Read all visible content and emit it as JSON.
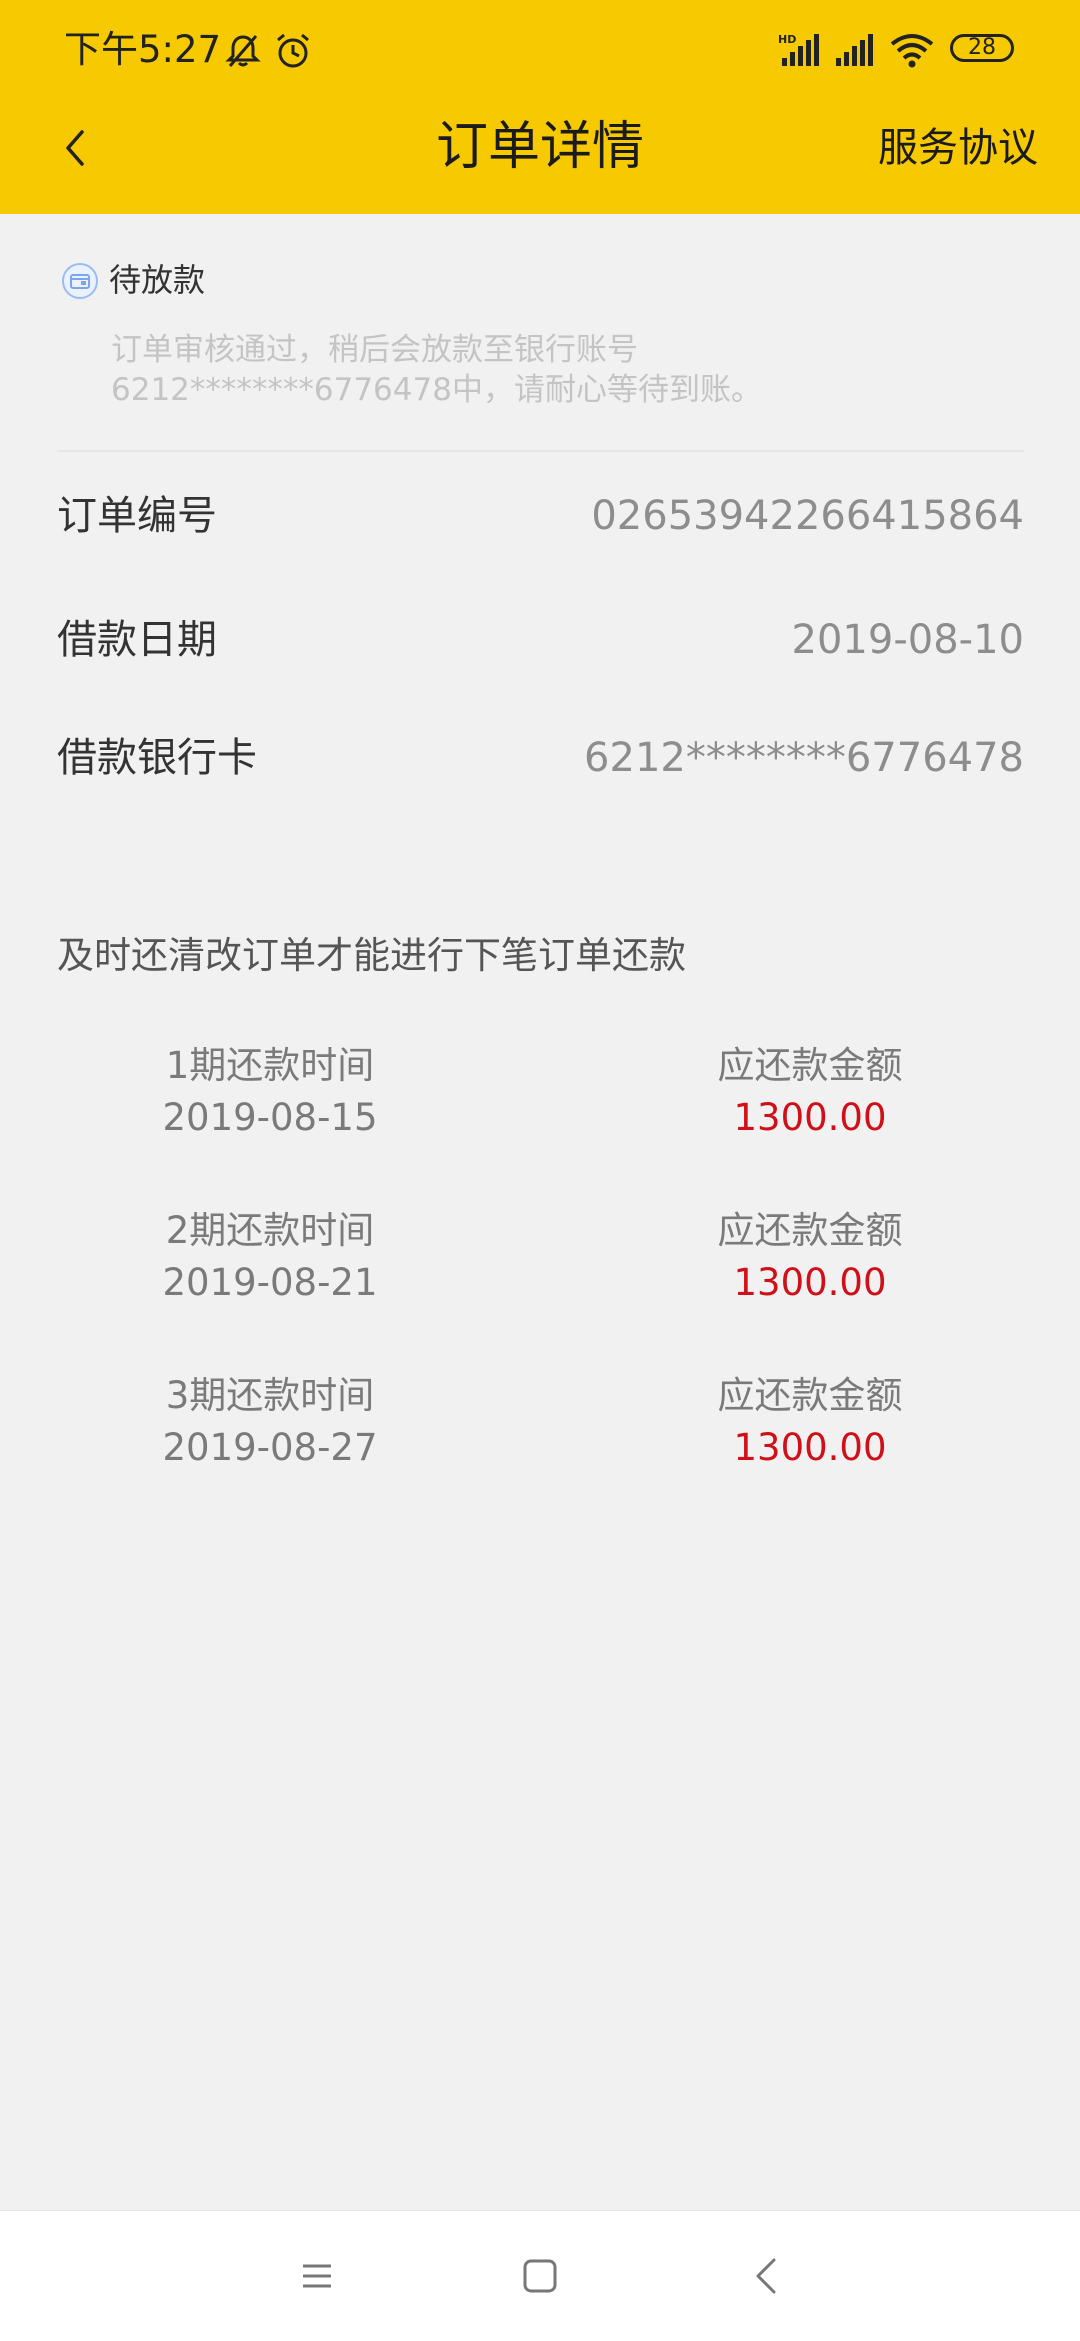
{
  "status_bar": {
    "time": "下午5:27",
    "battery": "28",
    "icons": [
      "silent-bell-icon",
      "alarm-icon",
      "hd-signal-icon",
      "signal-icon",
      "wifi-icon",
      "battery-icon"
    ]
  },
  "nav": {
    "back_icon": "chevron-left-icon",
    "title": "订单详情",
    "right_link": "服务协议"
  },
  "order_status": {
    "icon": "wallet-icon",
    "label": "待放款",
    "description_line1": "订单审核通过，稍后会放款至银行账号",
    "description_line2": "6212********6776478中，请耐心等待到账。"
  },
  "info": [
    {
      "label": "订单编号",
      "value": "02653942266415864"
    },
    {
      "label": "借款日期",
      "value": "2019-08-10"
    },
    {
      "label": "借款银行卡",
      "value": "6212********6776478"
    }
  ],
  "notice": "及时还清改订单才能进行下笔订单还款",
  "repayment_plans": [
    {
      "time_label": "1期还款时间",
      "date": "2019-08-15",
      "amount_label": "应还款金额",
      "amount": "1300.00"
    },
    {
      "time_label": "2期还款时间",
      "date": "2019-08-21",
      "amount_label": "应还款金额",
      "amount": "1300.00"
    },
    {
      "time_label": "3期还款时间",
      "date": "2019-08-27",
      "amount_label": "应还款金额",
      "amount": "1300.00"
    }
  ],
  "colors": {
    "header": "#f6c900",
    "background": "#f1f1f1",
    "amount": "#cf1019"
  },
  "bottom_nav": [
    "menu-icon",
    "home-icon",
    "back-icon"
  ]
}
